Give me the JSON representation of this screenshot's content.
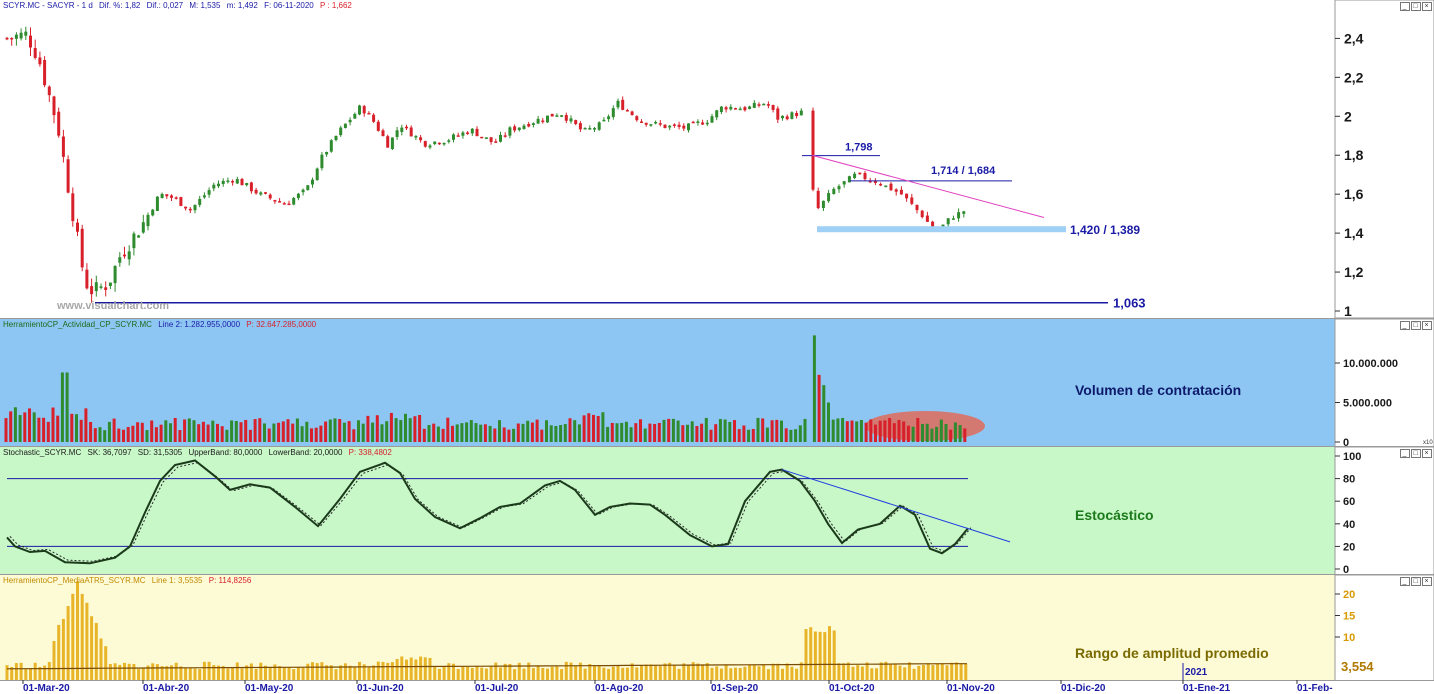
{
  "colors": {
    "bull": "#2e8b2e",
    "bear": "#d8202a",
    "volume_bg": "#8ec6f3",
    "stoch_bg": "#c8f7c8",
    "atr_bg": "#fdfbd6",
    "atr_bar": "#e8b52a",
    "label_blue": "#1a1aa6",
    "support_band": "#9fd0f5",
    "trendline_pink": "#e040c0"
  },
  "price_pane": {
    "header": {
      "symbol": "SCYR.MC - SACYR - 1 d",
      "dif_pct": "Dif. %: 1,82",
      "dif": "Dif.: 0,027",
      "max": "M: 1,535",
      "min": "m: 1,492",
      "date": "F: 06-11-2020",
      "p": "P : 1,662"
    },
    "watermark": "www.visualchart.com",
    "labels": {
      "high": "1,798",
      "resistance": "1,714 / 1,684",
      "support": "1,420 / 1,389",
      "low": "1,063"
    },
    "yticks": [
      "2,4",
      "2,2",
      "2",
      "1,8",
      "1,6",
      "1,4",
      "1,2",
      "1"
    ]
  },
  "volume_pane": {
    "header": {
      "name": "HerramientoCP_Actividad_CP_SCYR.MC",
      "line": "Line 2: 1.282.955,0000",
      "p": "P: 32.647.285,0000"
    },
    "title": "Volumen de contratación",
    "yticks": [
      "10.000.000",
      "5.000.000",
      "0"
    ],
    "scale_tag": "x10"
  },
  "stoch_pane": {
    "header": {
      "name": "Stochastic_SCYR.MC",
      "sk": "SK: 36,7097",
      "sd": "SD: 31,5305",
      "upper": "UpperBand: 80,0000",
      "lower": "LowerBand: 20,0000",
      "p": "P: 338,4802"
    },
    "title": "Estocástico",
    "yticks": [
      "100",
      "80",
      "60",
      "40",
      "20",
      "0"
    ]
  },
  "atr_pane": {
    "header": {
      "name": "HerramientoCP_MediaATR5_SCYR.MC",
      "line": "Line 1: 3,5535",
      "p": "P: 114,8256"
    },
    "title": "Rango de amplitud promedio",
    "yticks": [
      "20",
      "15",
      "10"
    ],
    "last_value": "3,554"
  },
  "date_axis": {
    "labels": [
      "01-Mar-20",
      "01-Abr-20",
      "01-May-20",
      "01-Jun-20",
      "01-Jul-20",
      "01-Ago-20",
      "01-Sep-20",
      "01-Oct-20",
      "01-Nov-20",
      "01-Dic-20",
      "01-Ene-21",
      "01-Feb-"
    ],
    "year_marker": "2021"
  },
  "chart_data": {
    "type": "candlestick",
    "symbol": "SCYR.MC - SACYR",
    "x_range": [
      "2020-03-01",
      "2021-02-01"
    ],
    "ylim": [
      1.0,
      2.5
    ],
    "annotated_levels": {
      "high": 1.798,
      "resistance": [
        1.714,
        1.684
      ],
      "support": [
        1.42,
        1.389
      ],
      "low": 1.063
    },
    "close_path": [
      {
        "date": "2020-02-25",
        "close": 2.4
      },
      {
        "date": "2020-03-02",
        "close": 2.42
      },
      {
        "date": "2020-03-05",
        "close": 2.3
      },
      {
        "date": "2020-03-10",
        "close": 1.95
      },
      {
        "date": "2020-03-13",
        "close": 1.6
      },
      {
        "date": "2020-03-17",
        "close": 1.15
      },
      {
        "date": "2020-03-19",
        "close": 1.1
      },
      {
        "date": "2020-03-23",
        "close": 1.14
      },
      {
        "date": "2020-03-26",
        "close": 1.28
      },
      {
        "date": "2020-04-01",
        "close": 1.45
      },
      {
        "date": "2020-04-06",
        "close": 1.6
      },
      {
        "date": "2020-04-10",
        "close": 1.58
      },
      {
        "date": "2020-04-15",
        "close": 1.52
      },
      {
        "date": "2020-04-22",
        "close": 1.65
      },
      {
        "date": "2020-04-28",
        "close": 1.68
      },
      {
        "date": "2020-05-05",
        "close": 1.6
      },
      {
        "date": "2020-05-12",
        "close": 1.55
      },
      {
        "date": "2020-05-18",
        "close": 1.62
      },
      {
        "date": "2020-05-22",
        "close": 1.78
      },
      {
        "date": "2020-05-27",
        "close": 1.92
      },
      {
        "date": "2020-06-02",
        "close": 2.05
      },
      {
        "date": "2020-06-05",
        "close": 1.98
      },
      {
        "date": "2020-06-09",
        "close": 1.85
      },
      {
        "date": "2020-06-12",
        "close": 1.96
      },
      {
        "date": "2020-06-18",
        "close": 1.86
      },
      {
        "date": "2020-06-24",
        "close": 1.88
      },
      {
        "date": "2020-06-30",
        "close": 1.93
      },
      {
        "date": "2020-07-06",
        "close": 1.86
      },
      {
        "date": "2020-07-10",
        "close": 1.93
      },
      {
        "date": "2020-07-17",
        "close": 1.98
      },
      {
        "date": "2020-07-23",
        "close": 2.02
      },
      {
        "date": "2020-07-29",
        "close": 1.92
      },
      {
        "date": "2020-08-03",
        "close": 1.96
      },
      {
        "date": "2020-08-07",
        "close": 2.07
      },
      {
        "date": "2020-08-13",
        "close": 1.98
      },
      {
        "date": "2020-08-19",
        "close": 1.95
      },
      {
        "date": "2020-08-25",
        "close": 1.94
      },
      {
        "date": "2020-08-31",
        "close": 1.98
      },
      {
        "date": "2020-09-04",
        "close": 2.05
      },
      {
        "date": "2020-09-10",
        "close": 2.04
      },
      {
        "date": "2020-09-15",
        "close": 2.07
      },
      {
        "date": "2020-09-18",
        "close": 1.99
      },
      {
        "date": "2020-09-24",
        "close": 2.02
      },
      {
        "date": "2020-09-25",
        "close": 1.78
      },
      {
        "date": "2020-09-28",
        "close": 1.52
      },
      {
        "date": "2020-10-02",
        "close": 1.62
      },
      {
        "date": "2020-10-08",
        "close": 1.7
      },
      {
        "date": "2020-10-14",
        "close": 1.66
      },
      {
        "date": "2020-10-20",
        "close": 1.6
      },
      {
        "date": "2020-10-26",
        "close": 1.48
      },
      {
        "date": "2020-10-29",
        "close": 1.4
      },
      {
        "date": "2020-11-02",
        "close": 1.48
      },
      {
        "date": "2020-11-06",
        "close": 1.52
      }
    ],
    "stochastic": {
      "upper_band": 80,
      "lower_band": 20,
      "sk_last": 36.7097,
      "sd_last": 31.5305
    },
    "atr_last": 3.5535
  }
}
